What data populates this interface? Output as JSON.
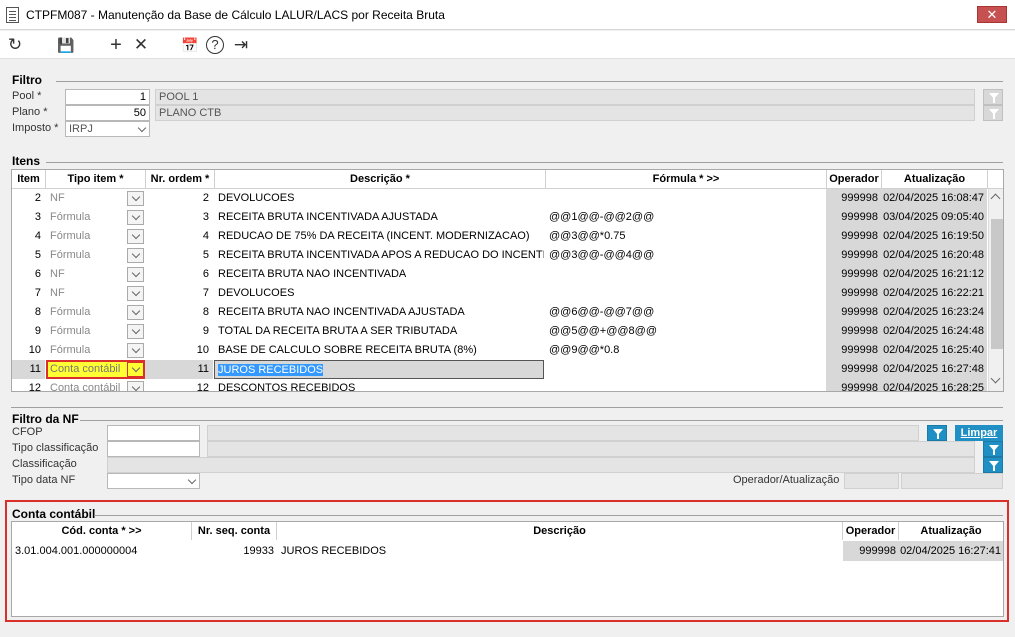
{
  "window": {
    "title": "CTPFM087 - Manutenção da Base de Cálculo LALUR/LACS por Receita Bruta",
    "close": "✕"
  },
  "toolbar": {
    "refresh": "↻",
    "save": "💾",
    "add": "+",
    "delete": "✕",
    "calendar": "📅",
    "help": "?",
    "exit": "⇥"
  },
  "filtro": {
    "title": "Filtro",
    "pool_label": "Pool *",
    "pool_value": "1",
    "pool_desc": "POOL 1",
    "plano_label": "Plano *",
    "plano_value": "50",
    "plano_desc": "PLANO CTB",
    "imposto_label": "Imposto *",
    "imposto_value": "IRPJ"
  },
  "itens": {
    "title": "Itens",
    "headers": {
      "item": "Item",
      "tipo": "Tipo item *",
      "ordem": "Nr. ordem *",
      "desc": "Descrição *",
      "formula": "Fórmula * >>",
      "oper": "Operador",
      "atu": "Atualização"
    },
    "rows": [
      {
        "item": "2",
        "tipo": "NF",
        "ordem": "2",
        "desc": "DEVOLUCOES",
        "formula": "",
        "oper": "999998",
        "atu": "02/04/2025 16:08:47"
      },
      {
        "item": "3",
        "tipo": "Fórmula",
        "ordem": "3",
        "desc": "RECEITA BRUTA INCENTIVADA AJUSTADA",
        "formula": "@@1@@-@@2@@",
        "oper": "999998",
        "atu": "03/04/2025 09:05:40"
      },
      {
        "item": "4",
        "tipo": "Fórmula",
        "ordem": "4",
        "desc": "REDUCAO DE 75% DA RECEITA (INCENT. MODERNIZACAO)",
        "formula": "@@3@@*0.75",
        "oper": "999998",
        "atu": "02/04/2025 16:19:50"
      },
      {
        "item": "5",
        "tipo": "Fórmula",
        "ordem": "5",
        "desc": "RECEITA BRUTA INCENTIVADA APOS A REDUCAO DO INCENTIVO",
        "formula": "@@3@@-@@4@@",
        "oper": "999998",
        "atu": "02/04/2025 16:20:48"
      },
      {
        "item": "6",
        "tipo": "NF",
        "ordem": "6",
        "desc": "RECEITA BRUTA NAO INCENTIVADA",
        "formula": "",
        "oper": "999998",
        "atu": "02/04/2025 16:21:12"
      },
      {
        "item": "7",
        "tipo": "NF",
        "ordem": "7",
        "desc": "DEVOLUCOES",
        "formula": "",
        "oper": "999998",
        "atu": "02/04/2025 16:22:21"
      },
      {
        "item": "8",
        "tipo": "Fórmula",
        "ordem": "8",
        "desc": "RECEITA BRUTA NAO INCENTIVADA AJUSTADA",
        "formula": "@@6@@-@@7@@",
        "oper": "999998",
        "atu": "02/04/2025 16:23:24"
      },
      {
        "item": "9",
        "tipo": "Fórmula",
        "ordem": "9",
        "desc": "TOTAL DA RECEITA BRUTA A SER TRIBUTADA",
        "formula": "@@5@@+@@8@@",
        "oper": "999998",
        "atu": "02/04/2025 16:24:48"
      },
      {
        "item": "10",
        "tipo": "Fórmula",
        "ordem": "10",
        "desc": "BASE DE CALCULO SOBRE RECEITA BRUTA (8%)",
        "formula": "@@9@@*0.8",
        "oper": "999998",
        "atu": "02/04/2025 16:25:40"
      },
      {
        "item": "11",
        "tipo": "Conta contábil",
        "ordem": "11",
        "desc": "JUROS RECEBIDOS",
        "formula": "",
        "oper": "999998",
        "atu": "02/04/2025 16:27:48"
      },
      {
        "item": "12",
        "tipo": "Conta contábil",
        "ordem": "12",
        "desc": "DESCONTOS RECEBIDOS",
        "formula": "",
        "oper": "999998",
        "atu": "02/04/2025 16:28:25"
      }
    ]
  },
  "filtro_nf": {
    "title": "Filtro da NF",
    "cfop_label": "CFOP",
    "tipo_class_label": "Tipo classificação",
    "class_label": "Classificação",
    "tipo_data_label": "Tipo data NF",
    "limpar": "Limpar",
    "oper_atu_label": "Operador/Atualização"
  },
  "conta": {
    "title": "Conta contábil",
    "headers": {
      "cod": "Cód. conta * >>",
      "seq": "Nr. seq. conta",
      "desc": "Descrição",
      "oper": "Operador",
      "atu": "Atualização"
    },
    "row": {
      "cod": "3.01.004.001.000000004",
      "seq": "19933",
      "desc": "JUROS RECEBIDOS",
      "oper": "999998",
      "atu": "02/04/2025 16:27:41"
    }
  },
  "colors": {
    "highlight": "#ffff33",
    "selection": "#3399ff",
    "annotation": "#d9302c"
  }
}
